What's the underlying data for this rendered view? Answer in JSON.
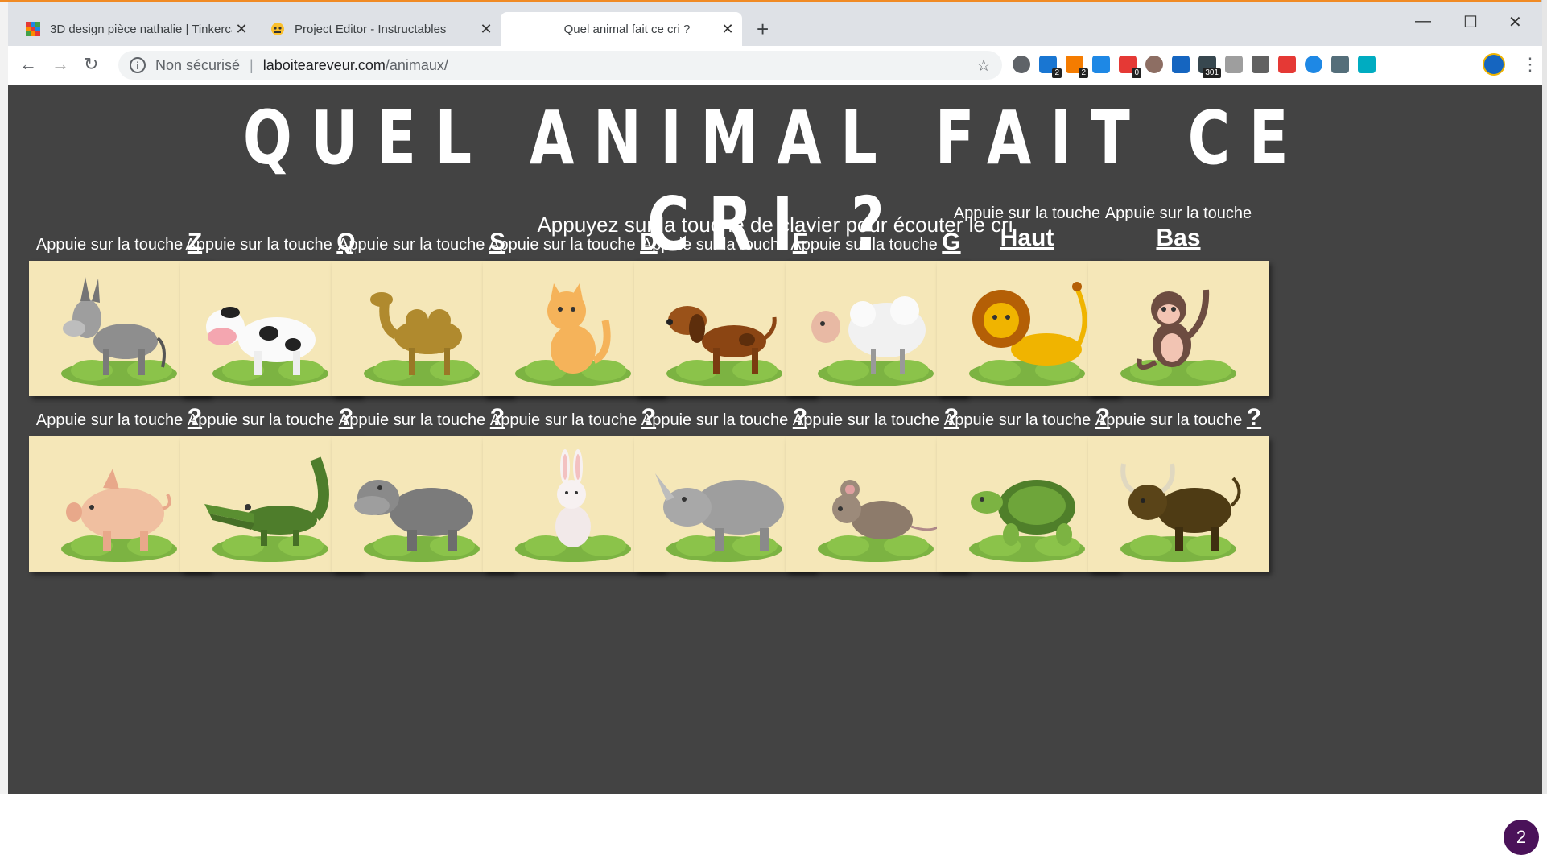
{
  "browser": {
    "tabs": [
      {
        "title": "3D design pièce nathalie | Tinkercad",
        "icon": "tinkercad-icon",
        "active": false
      },
      {
        "title": "Project Editor - Instructables",
        "icon": "instructables-icon",
        "active": false
      },
      {
        "title": "Quel animal fait ce cri ?",
        "icon": "blank-page-icon",
        "active": true
      }
    ],
    "security_label": "Non sécurisé",
    "url_host": "laboiteareveur.com",
    "url_path": "/animaux/",
    "extensions": [
      {
        "name": "search-ext-icon",
        "badge": ""
      },
      {
        "name": "ext-a-icon",
        "badge": "2"
      },
      {
        "name": "ext-b-icon",
        "badge": "2"
      },
      {
        "name": "ext-c-icon",
        "badge": ""
      },
      {
        "name": "ext-d-icon",
        "badge": "0"
      },
      {
        "name": "cookie-icon",
        "badge": ""
      },
      {
        "name": "ext-e-icon",
        "badge": ""
      },
      {
        "name": "ext-f-icon",
        "badge": "301"
      },
      {
        "name": "ext-g-icon",
        "badge": ""
      },
      {
        "name": "ext-h-icon",
        "badge": ""
      },
      {
        "name": "pocket-icon",
        "badge": ""
      },
      {
        "name": "check-icon",
        "badge": ""
      },
      {
        "name": "grid-icon",
        "badge": ""
      },
      {
        "name": "gear-ext-icon",
        "badge": ""
      }
    ]
  },
  "page": {
    "title": "QUEL ANIMAL FAIT CE CRI ?",
    "subtitle": "Appuyez sur la touche de clavier pour écouter le cri",
    "label_prefix": "Appuie sur la touche",
    "row1": [
      {
        "key": "Z",
        "animal": "donkey"
      },
      {
        "key": "Q",
        "animal": "cow"
      },
      {
        "key": "S",
        "animal": "camel"
      },
      {
        "key": "D",
        "animal": "cat"
      },
      {
        "key": "F",
        "animal": "dog"
      },
      {
        "key": "G",
        "animal": "sheep"
      },
      {
        "key": "Haut",
        "animal": "lion"
      },
      {
        "key": "Bas",
        "animal": "monkey"
      }
    ],
    "row2": [
      {
        "key": "?",
        "animal": "pig"
      },
      {
        "key": "?",
        "animal": "crocodile"
      },
      {
        "key": "?",
        "animal": "hippo"
      },
      {
        "key": "?",
        "animal": "rabbit"
      },
      {
        "key": "?",
        "animal": "rhino"
      },
      {
        "key": "?",
        "animal": "mouse"
      },
      {
        "key": "?",
        "animal": "turtle"
      },
      {
        "key": "?",
        "animal": "bull"
      }
    ],
    "notification_count": "2"
  }
}
